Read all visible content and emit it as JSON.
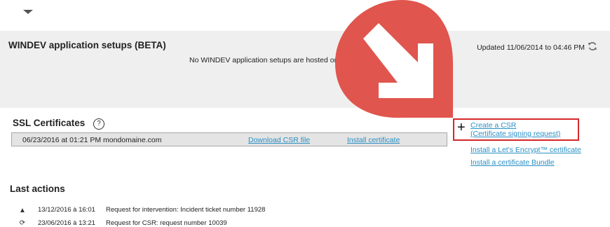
{
  "windev": {
    "title": "WINDEV application setups (BETA)",
    "empty_message": "No WINDEV application setups are hosted on",
    "updated": "Updated 11/06/2014 to 04:46 PM"
  },
  "ssl": {
    "title": "SSL Certificates",
    "help": "?",
    "certificate": {
      "date": "06/23/2016 at 01:21 PM  mondomaine.com",
      "download_label": "Download CSR file",
      "install_label": "Install certificate"
    },
    "create_csr_line1": "Create a CSR",
    "create_csr_line2": "(Certificate signing request)",
    "lets_encrypt_label": "Install a Let's Encrypt™ certificate",
    "bundle_label": "Install a certificate Bundle"
  },
  "last_actions": {
    "title": "Last actions",
    "items": [
      {
        "icon": "warning-icon",
        "date": "13/12/2016 à 16:01",
        "text": "Request for intervention: Incident ticket number 11928"
      },
      {
        "icon": "sync-icon",
        "date": "23/06/2016 à 13:21",
        "text": "Request for CSR: request number 10039"
      }
    ]
  },
  "colors": {
    "link": "#2a8fc4",
    "highlight_border": "#d62828",
    "arrow_badge": "#e0554d"
  }
}
